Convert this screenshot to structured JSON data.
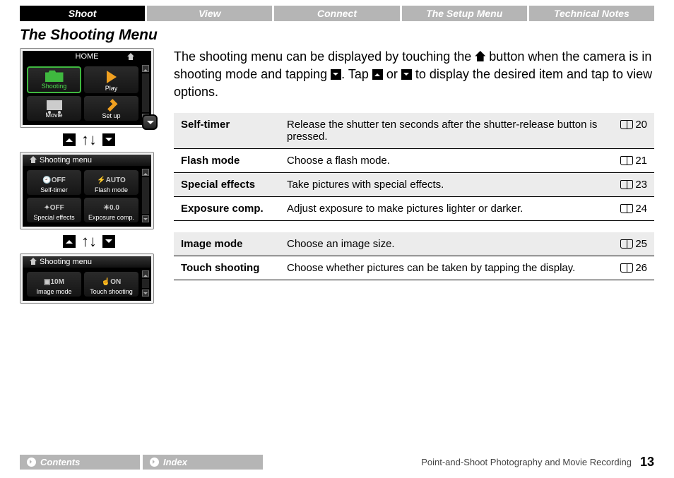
{
  "tabs": [
    "Shoot",
    "View",
    "Connect",
    "The Setup Menu",
    "Technical Notes"
  ],
  "active_tab": 0,
  "heading": "The Shooting Menu",
  "intro_parts": {
    "a": "The shooting menu can be displayed by touching the ",
    "b": " button when the camera is in shooting mode and tapping ",
    "c": ". Tap ",
    "d": " or ",
    "e": " to display the desired item and tap to view options."
  },
  "lcd1": {
    "title": "HOME",
    "cells": [
      {
        "label": "Shooting",
        "icon": "cam",
        "green": true
      },
      {
        "label": "Play",
        "icon": "play"
      },
      {
        "label": "Movie",
        "icon": "movie"
      },
      {
        "label": "Set up",
        "icon": "wrench"
      }
    ]
  },
  "lcd2": {
    "title": "Shooting menu",
    "cells": [
      {
        "label": "Self-timer",
        "text": "OFF"
      },
      {
        "label": "Flash mode",
        "text": "AUTO"
      },
      {
        "label": "Special effects",
        "text": "OFF"
      },
      {
        "label": "Exposure comp.",
        "text": "0.0"
      }
    ]
  },
  "lcd3": {
    "title": "Shooting menu",
    "cells": [
      {
        "label": "Image mode",
        "text": "10M"
      },
      {
        "label": "Touch shooting",
        "text": "ON"
      }
    ]
  },
  "table": [
    {
      "name": "Self-timer",
      "desc": "Release the shutter ten seconds after the shutter-release button is pressed.",
      "page": "20",
      "shade": true
    },
    {
      "name": "Flash mode",
      "desc": "Choose a flash mode.",
      "page": "21"
    },
    {
      "name": "Special effects",
      "desc": "Take pictures with special effects.",
      "page": "23",
      "shade": true
    },
    {
      "name": "Exposure comp.",
      "desc": "Adjust exposure to make pictures lighter or darker.",
      "page": "24"
    },
    {
      "gap": true
    },
    {
      "name": "Image mode",
      "desc": "Choose an image size.",
      "page": "25",
      "shade": true
    },
    {
      "name": "Touch shooting",
      "desc": "Choose whether pictures can be taken by tapping the display.",
      "page": "26"
    }
  ],
  "footer": {
    "contents": "Contents",
    "index": "Index",
    "caption": "Point-and-Shoot Photography and Movie Recording",
    "page": "13"
  }
}
